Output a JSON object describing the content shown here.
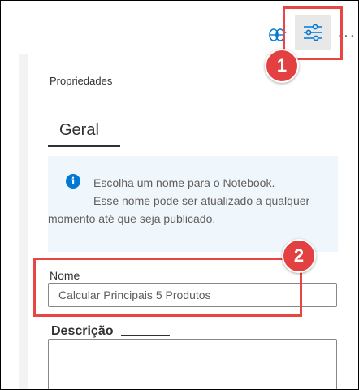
{
  "toolbar": {
    "notebook_icon": "notebook-sync-icon",
    "properties_icon": "sliders-icon",
    "more_label": "···"
  },
  "annotations": {
    "step1": "1",
    "step2": "2",
    "highlight_color": "#e84545"
  },
  "panel": {
    "title": "Propriedades",
    "tab_general": "Geral",
    "info": {
      "line1": "Escolha um nome para o Notebook.",
      "line2": "Esse nome pode ser atualizado a qualquer",
      "line3": "momento até que seja publicado."
    },
    "name_label": "Nome",
    "name_value": "Calcular Principais 5 Produtos",
    "description_label": "Descrição",
    "description_value": ""
  },
  "colors": {
    "accent": "#0078d4",
    "info_bg": "#eff6fc",
    "badge": "#e34141"
  }
}
